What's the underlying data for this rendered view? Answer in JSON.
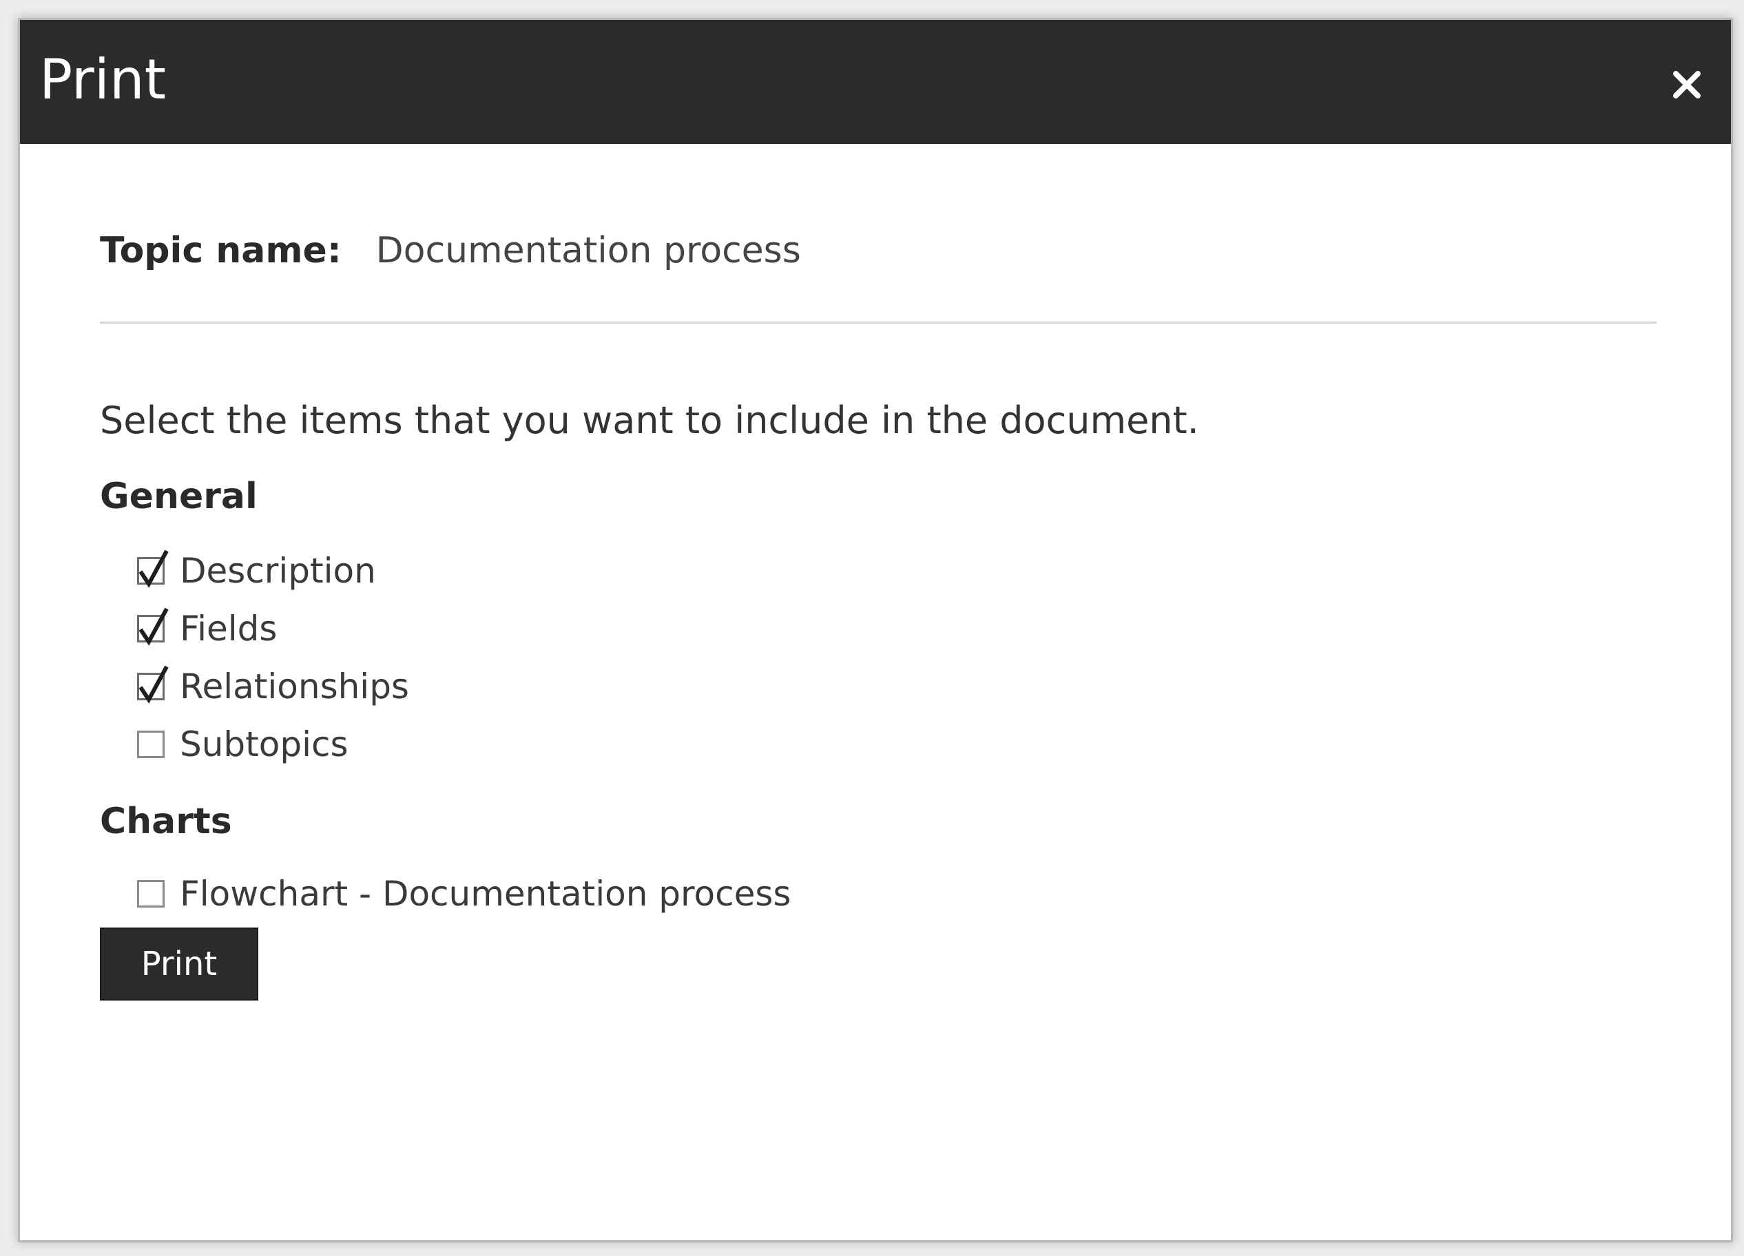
{
  "dialog": {
    "title": "Print",
    "close_icon": "close-icon"
  },
  "topic": {
    "label": "Topic name:",
    "value": "Documentation process"
  },
  "instruction": "Select the items that you want to include in the document.",
  "sections": {
    "general": {
      "title": "General",
      "items": [
        {
          "label": "Description",
          "checked": true
        },
        {
          "label": "Fields",
          "checked": true
        },
        {
          "label": "Relationships",
          "checked": true
        },
        {
          "label": "Subtopics",
          "checked": false
        }
      ]
    },
    "charts": {
      "title": "Charts",
      "items": [
        {
          "label": "Flowchart - Documentation process",
          "checked": false
        }
      ]
    }
  },
  "actions": {
    "print_label": "Print"
  },
  "colors": {
    "titlebar": "#2b2b2b",
    "button": "#2b2b2b"
  }
}
